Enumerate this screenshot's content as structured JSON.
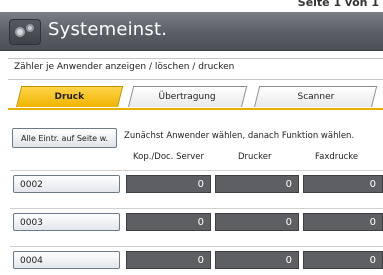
{
  "header_strip": {
    "text": "Seite 1 von 1"
  },
  "titlebar": {
    "title": "Systemeinst.",
    "icon": "settings-gear-icon"
  },
  "subheader": {
    "text": "Zähler je Anwender anzeigen / löschen / drucken"
  },
  "tabs": [
    {
      "label": "Druck",
      "active": true
    },
    {
      "label": "Übertragung",
      "active": false
    },
    {
      "label": "Scanner",
      "active": false
    }
  ],
  "all_entries_button": "Alle Eintr. auf Seite w.",
  "instruction": "Zunächst Anwender wählen, danach Funktion wählen.",
  "columns": [
    "Kop./Doc. Server",
    "Drucker",
    "Faxdrucke"
  ],
  "rows": [
    {
      "user": "0002",
      "values": [
        "0",
        "0",
        "0"
      ]
    },
    {
      "user": "0003",
      "values": [
        "0",
        "0",
        "0"
      ]
    },
    {
      "user": "0004",
      "values": [
        "0",
        "0",
        "0"
      ]
    }
  ],
  "colors": {
    "accent": "#f0b400",
    "cell": "#5e5f62",
    "titlebar": "#5a5f66"
  }
}
